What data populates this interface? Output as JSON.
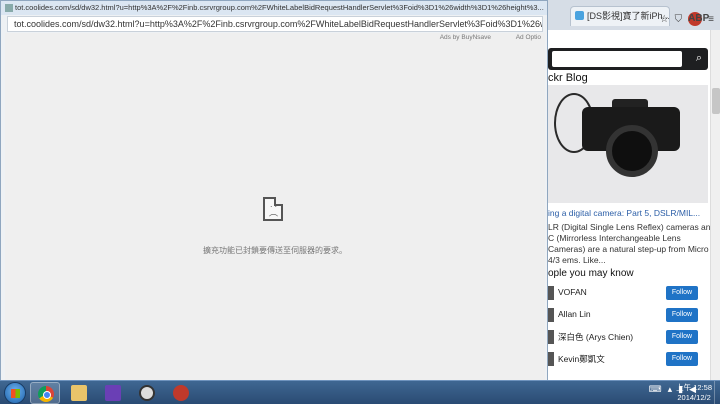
{
  "popup": {
    "title_url": "tot.coolides.com/sd/dw32.html?u=http%3A%2F%2Finb.csrvrgroup.com%2FWhiteLabelBidRequestHandlerServlet%3Foid%3D1%26width%3D1%26height%3...",
    "address_url": "tot.coolides.com/sd/dw32.html?u=http%3A%2F%2Finb.csrvrgroup.com%2FWhiteLabelBidRequestHandlerServlet%3Foid%3D1%26width%3D1%26height%3D1%26wi",
    "ads_by": "Ads by BuyNsave",
    "ad_options": "Ad Optio",
    "error_message": "擴充功能已封鎖要傳送至伺服器的要求。"
  },
  "background_browser": {
    "tab_label": "[DS影視]寶了新iPh...",
    "blog_title": "ckr Blog",
    "article_link": "ing a digital camera: Part 5, DSLR/MIL...",
    "article_text": "LR (Digital Single Lens Reflex) cameras and C (Mirrorless Interchangeable Lens Cameras) are a natural step-up from Micro 4/3 ems. Like...",
    "people_title": "ople you may know",
    "people": [
      {
        "name": "VOFAN",
        "follow": "Follow"
      },
      {
        "name": "Allan Lin",
        "follow": "Follow"
      },
      {
        "name": "深白色 (Arys Chien)",
        "follow": "Follow"
      },
      {
        "name": "Kevin鄭凱文",
        "follow": "Follow"
      }
    ]
  },
  "taskbar": {
    "clock_time": "上午 12:58",
    "clock_date": "2014/12/2",
    "icons": [
      "start-orb",
      "chrome-icon",
      "folder-icon",
      "visual-studio-icon",
      "app-icon",
      "media-icon"
    ]
  },
  "colors": {
    "follow_button": "#1f73c6",
    "taskbar": "#2a4b73"
  }
}
